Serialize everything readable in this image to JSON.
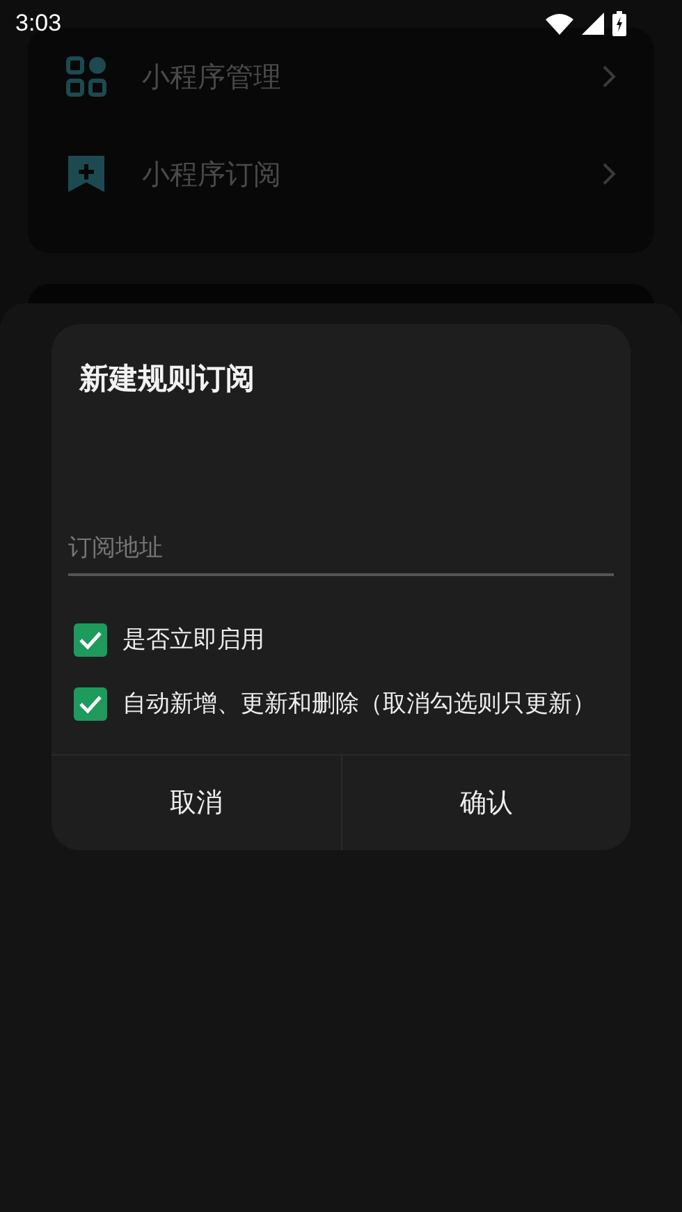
{
  "status_bar": {
    "time": "3:03"
  },
  "menu": [
    {
      "label": "小程序管理",
      "kind": "apps"
    },
    {
      "label": "小程序订阅",
      "kind": "subscribe"
    }
  ],
  "dialog": {
    "title": "新建规则订阅",
    "field": {
      "placeholder": "订阅地址"
    },
    "options": [
      {
        "label": "是否立即启用",
        "checked": true
      },
      {
        "label": "自动新增、更新和删除（取消勾选则只更新）",
        "checked": true
      }
    ],
    "buttons": [
      "取消",
      "确认"
    ]
  }
}
